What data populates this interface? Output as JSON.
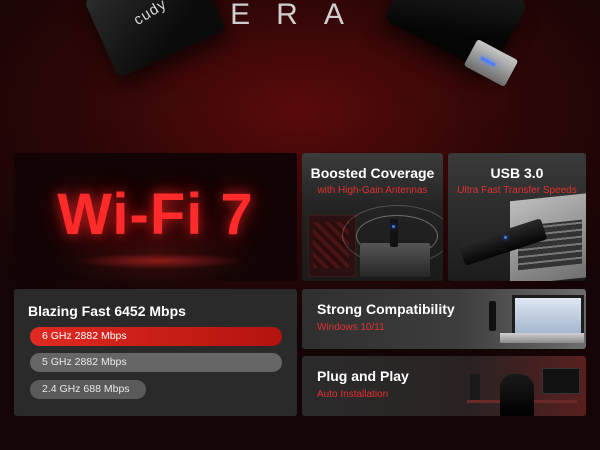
{
  "hero": {
    "word": "ERA",
    "brand": "cudy"
  },
  "tiles": {
    "wifi": {
      "label": "Wi-Fi 7"
    },
    "coverage": {
      "title": "Boosted Coverage",
      "subtitle": "with High-Gain Antennas"
    },
    "usb": {
      "title": "USB 3.0",
      "subtitle": "Ultra Fast Transfer Speeds"
    },
    "speed": {
      "title": "Blazing Fast 6452 Mbps",
      "bands": [
        {
          "label": "6 GHz 2882 Mbps"
        },
        {
          "label": "5 GHz 2882 Mbps"
        },
        {
          "label": "2.4 GHz 688 Mbps"
        }
      ]
    },
    "compatibility": {
      "title": "Strong Compatibility",
      "subtitle": "Windows 10/11"
    },
    "plug": {
      "title": "Plug and Play",
      "subtitle": "Auto Installation"
    }
  },
  "colors": {
    "accent": "#e02a22",
    "background": "#140405"
  }
}
